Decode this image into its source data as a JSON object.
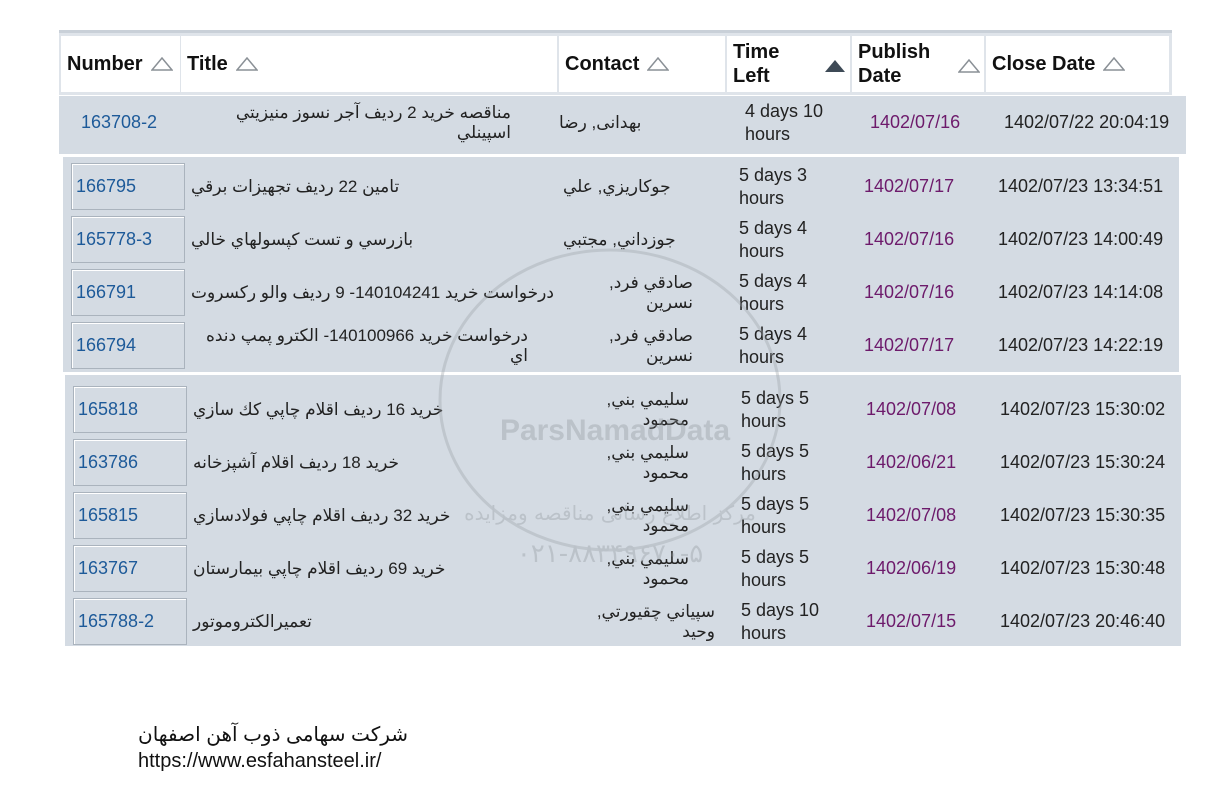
{
  "columns": {
    "number": "Number",
    "title": "Title",
    "contact": "Contact",
    "time_left_1": "Time",
    "time_left_2": "Left",
    "publish_1": "Publish",
    "publish_2": "Date",
    "close_date": "Close Date"
  },
  "rows": [
    {
      "number": "163708-2",
      "title": "مناقصه خريد 2 رديف آجر نسوز منيزيتي اسپينلي",
      "contact": "بهدانى, رضا",
      "time_1": "4 days 10",
      "time_2": "hours",
      "publish": "1402/07/16",
      "close": "1402/07/22 20:04:19"
    },
    {
      "number": "166795",
      "title": "تامين 22 رديف تجهيزات برقي",
      "contact": "جوكاريزي, علي",
      "time_1": "5 days 3",
      "time_2": "hours",
      "publish": "1402/07/17",
      "close": "1402/07/23 13:34:51"
    },
    {
      "number": "165778-3",
      "title": "بازرسي و تست كپسولهاي خالي",
      "contact": "جوزداني, مجتبي",
      "time_1": "5 days 4",
      "time_2": "hours",
      "publish": "1402/07/16",
      "close": "1402/07/23 14:00:49"
    },
    {
      "number": "166791",
      "title": "درخواست خريد 140104241- 9 رديف والو ركسروت",
      "contact": "صادقي فرد, نسرين",
      "time_1": "5 days 4",
      "time_2": "hours",
      "publish": "1402/07/16",
      "close": "1402/07/23 14:14:08"
    },
    {
      "number": "166794",
      "title": "درخواست خريد 140100966- الكترو پمپ دنده اي",
      "contact": "صادقي فرد, نسرين",
      "time_1": "5 days 4",
      "time_2": "hours",
      "publish": "1402/07/17",
      "close": "1402/07/23 14:22:19"
    },
    {
      "number": "165818",
      "title": "خريد 16 رديف اقلام چاپي كك سازي",
      "contact": "سليمي بني, محمود",
      "time_1": "5 days 5",
      "time_2": "hours",
      "publish": "1402/07/08",
      "close": "1402/07/23 15:30:02"
    },
    {
      "number": "163786",
      "title": "خريد 18 رديف اقلام آشپزخانه",
      "contact": "سليمي بني, محمود",
      "time_1": "5 days 5",
      "time_2": "hours",
      "publish": "1402/06/21",
      "close": "1402/07/23 15:30:24"
    },
    {
      "number": "165815",
      "title": "خريد 32 رديف اقلام چاپي فولادسازي",
      "contact": "سليمي بني, محمود",
      "time_1": "5 days 5",
      "time_2": "hours",
      "publish": "1402/07/08",
      "close": "1402/07/23 15:30:35"
    },
    {
      "number": "163767",
      "title": "خريد 69 رديف اقلام چاپي بيمارستان",
      "contact": "سليمي بني, محمود",
      "time_1": "5 days 5",
      "time_2": "hours",
      "publish": "1402/06/19",
      "close": "1402/07/23 15:30:48"
    },
    {
      "number": "165788-2",
      "title": "تعميرالكتروموتور",
      "contact": "سپياني چقيورتي, وحيد",
      "time_1": "5 days 10",
      "time_2": "hours",
      "publish": "1402/07/15",
      "close": "1402/07/23 20:46:40"
    }
  ],
  "footer": {
    "company": "شركت سهامی ذوب آهن اصفهان",
    "url": "https://www.esfahansteel.ir/"
  },
  "watermark": {
    "brand": "ParsNamadData",
    "tagline": "مرکز اطلاع رسانی مناقصه ومزایده",
    "phone": "۰۲۱-۸۸۳۴۹۶۷۰-۵"
  }
}
